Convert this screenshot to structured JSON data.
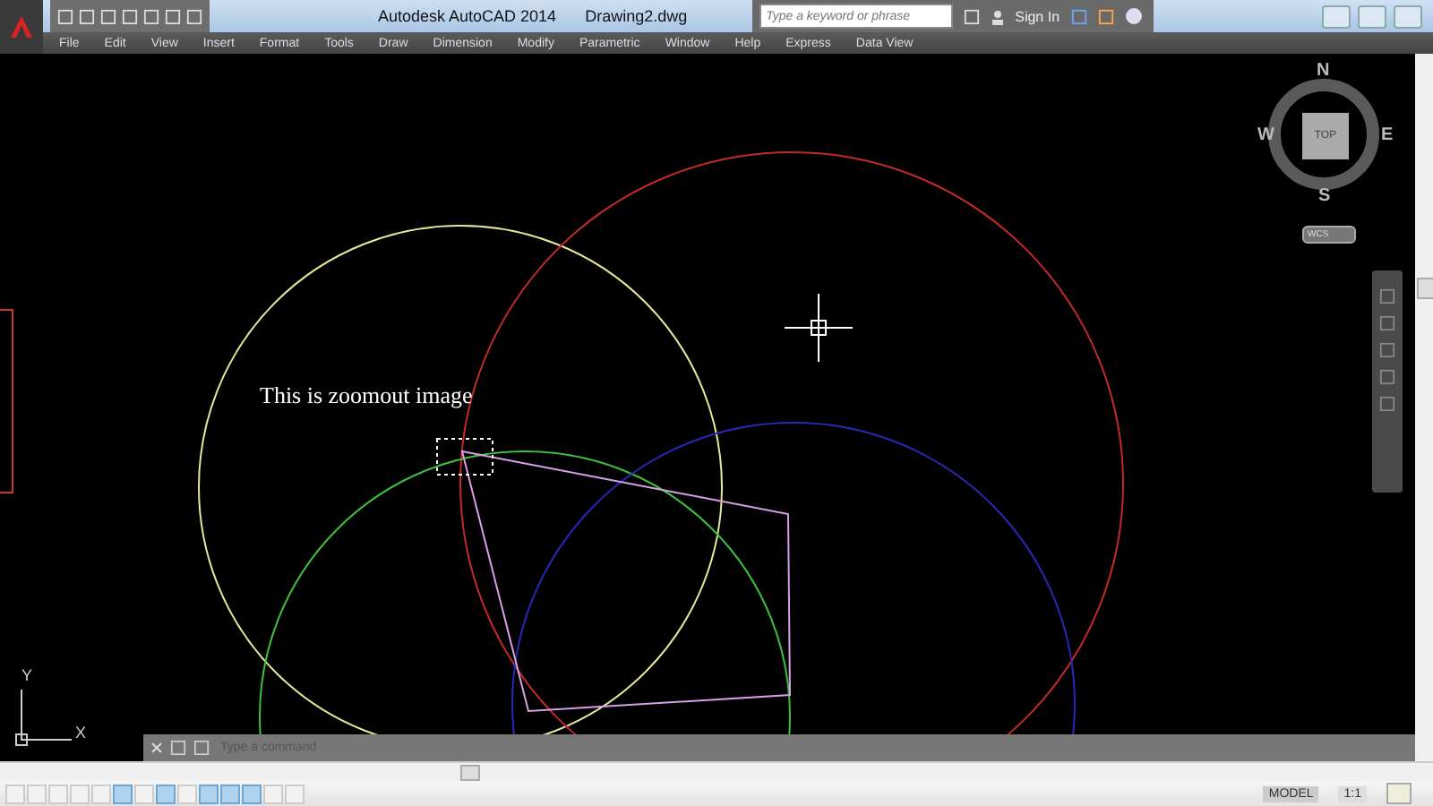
{
  "title_bar": {
    "app_title": "Autodesk AutoCAD 2014",
    "file_name": "Drawing2.dwg",
    "search": {
      "placeholder": "Type a keyword or phrase"
    },
    "sign_in": "Sign In"
  },
  "menu": [
    "File",
    "Edit",
    "View",
    "Insert",
    "Format",
    "Tools",
    "Draw",
    "Dimension",
    "Modify",
    "Parametric",
    "Window",
    "Help",
    "Express",
    "Data View"
  ],
  "canvas": {
    "annotation": "This is zoomout image",
    "viewcube": {
      "north": "N",
      "south": "S",
      "east": "E",
      "west": "W",
      "face": "TOP",
      "ucs": "WCS"
    },
    "ucs_axes": {
      "x": "X",
      "y": "Y"
    }
  },
  "command_line": {
    "placeholder": "Type a command"
  },
  "status_bar": {
    "toggles": [
      {
        "on": false
      },
      {
        "on": false
      },
      {
        "on": false
      },
      {
        "on": false
      },
      {
        "on": false
      },
      {
        "on": true
      },
      {
        "on": false
      },
      {
        "on": true
      },
      {
        "on": false
      },
      {
        "on": true
      },
      {
        "on": true
      },
      {
        "on": true
      },
      {
        "on": false
      },
      {
        "on": false
      }
    ],
    "model": "MODEL",
    "scale": "1:1"
  }
}
